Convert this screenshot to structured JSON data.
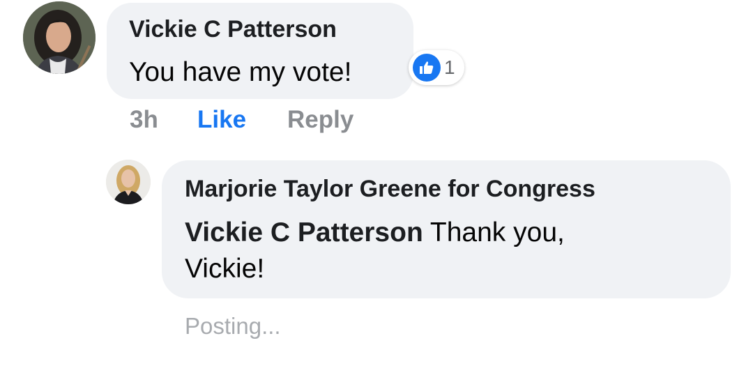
{
  "comment": {
    "author": "Vickie C Patterson",
    "text": "You have my vote!",
    "reaction_count": "1",
    "reaction_icon": "like-thumbs-up-icon",
    "time": "3h",
    "like_label": "Like",
    "reply_label": "Reply"
  },
  "reply": {
    "author": "Marjorie Taylor Greene for Congress",
    "mention": "Vickie C Patterson",
    "text": " Thank you, Vickie!",
    "status": "Posting..."
  },
  "colors": {
    "bubble": "#f0f2f5",
    "like_blue": "#1877f2",
    "meta_gray": "#8a8d91",
    "posting_gray": "#a8abaf"
  }
}
